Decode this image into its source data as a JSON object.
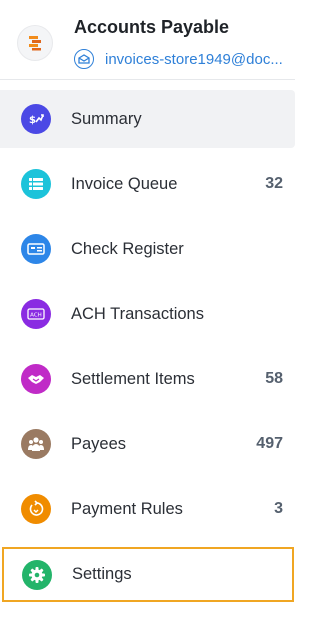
{
  "header": {
    "title": "Accounts Payable",
    "account": "invoices-store1949@doc..."
  },
  "nav": {
    "items": [
      {
        "label": "Summary",
        "count": "",
        "icon": "summary-icon",
        "color": "#4b49e5"
      },
      {
        "label": "Invoice Queue",
        "count": "32",
        "icon": "invoice-queue-icon",
        "color": "#1cc3da"
      },
      {
        "label": "Check Register",
        "count": "",
        "icon": "check-register-icon",
        "color": "#2d86e8"
      },
      {
        "label": "ACH Transactions",
        "count": "",
        "icon": "ach-icon",
        "color": "#8a2be2"
      },
      {
        "label": "Settlement Items",
        "count": "58",
        "icon": "settlement-icon",
        "color": "#c02bc7"
      },
      {
        "label": "Payees",
        "count": "497",
        "icon": "payees-icon",
        "color": "#9a7a62"
      },
      {
        "label": "Payment Rules",
        "count": "3",
        "icon": "payment-rules-icon",
        "color": "#f08c00"
      },
      {
        "label": "Settings",
        "count": "",
        "icon": "settings-icon",
        "color": "#23b46a"
      }
    ],
    "active_index": 0,
    "focused_index": 7
  },
  "colors": {
    "accent_link": "#2f80d8",
    "focus_outline": "#f0a623",
    "active_bg": "#f1f2f4"
  }
}
